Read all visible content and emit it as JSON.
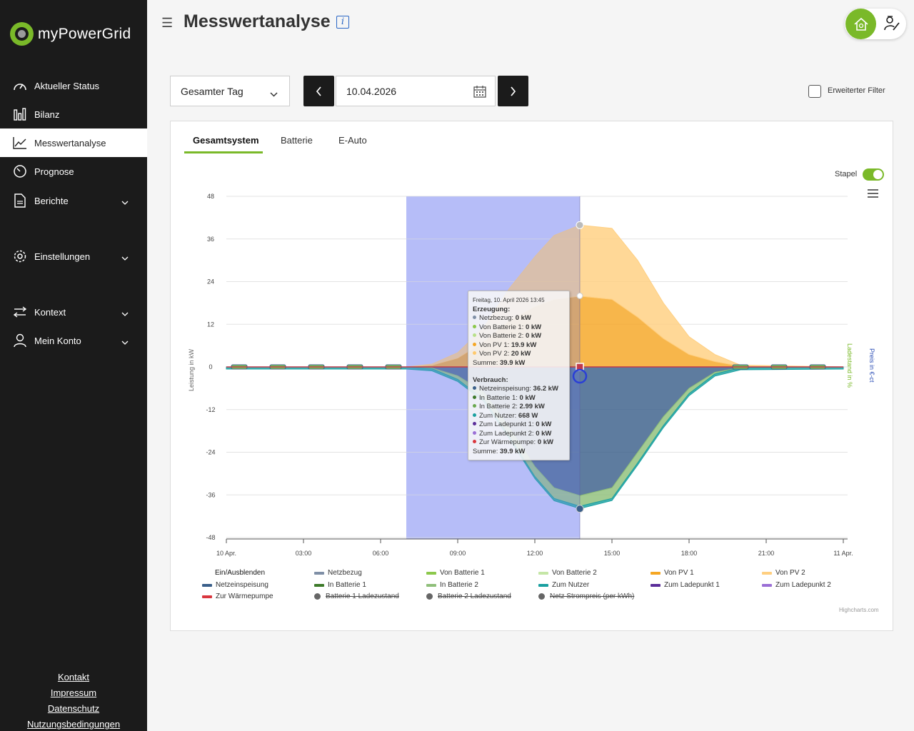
{
  "app": {
    "name": "myPowerGrid"
  },
  "sidebar": {
    "items": [
      {
        "label": "Aktueller Status",
        "icon": "gauge-icon"
      },
      {
        "label": "Bilanz",
        "icon": "bar-chart-icon"
      },
      {
        "label": "Messwertanalyse",
        "icon": "line-chart-icon",
        "active": true
      },
      {
        "label": "Prognose",
        "icon": "timer-icon"
      },
      {
        "label": "Berichte",
        "icon": "document-icon",
        "expandable": true
      },
      {
        "label": "Einstellungen",
        "icon": "gear-icon",
        "expandable": true
      },
      {
        "label": "Kontext",
        "icon": "swap-arrows-icon",
        "expandable": true
      },
      {
        "label": "Mein Konto",
        "icon": "user-icon",
        "expandable": true
      }
    ],
    "footer": [
      "Kontakt",
      "Impressum",
      "Datenschutz",
      "Nutzungsbedingungen"
    ]
  },
  "header": {
    "title": "Messwertanalyse",
    "info_icon": "i"
  },
  "controls": {
    "period": "Gesamter Tag",
    "date": "10.04.2026",
    "filter_label": "Erweiterter Filter",
    "filter_checked": false
  },
  "tabs": [
    "Gesamtsystem",
    "Batterie",
    "E-Auto"
  ],
  "active_tab": "Gesamtsystem",
  "stack_label": "Stapel",
  "stack_enabled": true,
  "tooltip": {
    "date": "Freitag, 10. April 2026 13:45",
    "gen_title": "Erzeugung:",
    "gen": [
      {
        "label": "Netzbezug:",
        "value": "0 kW",
        "color": "#7f8fa6"
      },
      {
        "label": "Von Batterie 1:",
        "value": "0 kW",
        "color": "#8cc84b"
      },
      {
        "label": "Von Batterie 2:",
        "value": "0 kW",
        "color": "#b8e08a"
      },
      {
        "label": "Von PV 1:",
        "value": "19.9 kW",
        "color": "#f5a623"
      },
      {
        "label": "Von PV 2:",
        "value": "20 kW",
        "color": "#ffc96b"
      }
    ],
    "gen_sum": {
      "label": "Summe:",
      "value": "39.9 kW"
    },
    "cons_title": "Verbrauch:",
    "cons": [
      {
        "label": "Netzeinspeisung:",
        "value": "36.2 kW",
        "color": "#3a5f8a"
      },
      {
        "label": "In Batterie 1:",
        "value": "0 kW",
        "color": "#3d7a2a"
      },
      {
        "label": "In Batterie 2:",
        "value": "2.99 kW",
        "color": "#6aa84f"
      },
      {
        "label": "Zum Nutzer:",
        "value": "668 W",
        "color": "#1aa0a0"
      },
      {
        "label": "Zum Ladepunkt 1:",
        "value": "0 kW",
        "color": "#5b2d9a"
      },
      {
        "label": "Zum Ladepunkt 2:",
        "value": "0 kW",
        "color": "#9b6fd6"
      },
      {
        "label": "Zur Wärmepumpe:",
        "value": "0 kW",
        "color": "#d9363e"
      }
    ],
    "cons_sum": {
      "label": "Summe:",
      "value": "39.9 kW"
    }
  },
  "legend": {
    "title": "Ein/Ausblenden",
    "items": [
      {
        "label": "Netzbezug",
        "color": "#7f8fa6",
        "type": "line"
      },
      {
        "label": "Von Batterie 1",
        "color": "#8cc84b",
        "type": "line"
      },
      {
        "label": "Von Batterie 2",
        "color": "#c5e6a6",
        "type": "line"
      },
      {
        "label": "Von PV 1",
        "color": "#f5a623",
        "type": "line"
      },
      {
        "label": "Von PV 2",
        "color": "#ffcf80",
        "type": "line"
      },
      {
        "label": "Netzeinspeisung",
        "color": "#3a5f8a",
        "type": "line"
      },
      {
        "label": "In Batterie 1",
        "color": "#3d7a2a",
        "type": "line"
      },
      {
        "label": "In Batterie 2",
        "color": "#8fbf7a",
        "type": "line"
      },
      {
        "label": "Zum Nutzer",
        "color": "#1aa0a0",
        "type": "line"
      },
      {
        "label": "Zum Ladepunkt 1",
        "color": "#5b2d9a",
        "type": "line"
      },
      {
        "label": "Zum Ladepunkt 2",
        "color": "#9b6fd6",
        "type": "line"
      },
      {
        "label": "Zur Wärmepumpe",
        "color": "#d9363e",
        "type": "line"
      },
      {
        "label": "Batterie 1 Ladezustand",
        "color": "#666666",
        "type": "circle",
        "hidden": true
      },
      {
        "label": "Batterie 2 Ladezustand",
        "color": "#666666",
        "type": "circle",
        "hidden": true
      },
      {
        "label": "Netz Strompreis (per kWh)",
        "color": "#666666",
        "type": "circle",
        "hidden": true
      }
    ]
  },
  "credits": "Highcharts.com",
  "chart_data": {
    "type": "area",
    "stacked": true,
    "ylabel": "Leistung in kW",
    "ylabel_right_1": "Ladestand in %",
    "ylabel_right_2": "Preis in €-ct",
    "ylim": [
      -48,
      48
    ],
    "yticks": [
      "48",
      "36",
      "24",
      "12",
      "0",
      "-12",
      "-24",
      "-36",
      "-48"
    ],
    "xtick_labels": [
      "10 Apr.",
      "03:00",
      "06:00",
      "09:00",
      "12:00",
      "15:00",
      "18:00",
      "21:00",
      "11 Apr."
    ],
    "x_hours": [
      0,
      3,
      6,
      7,
      8,
      9,
      10,
      11,
      12,
      12.75,
      13.75,
      15,
      16,
      17,
      18,
      19,
      20,
      24
    ],
    "series": [
      {
        "name": "Von PV 1",
        "color": "#f5a623",
        "values": [
          0,
          0,
          0,
          0,
          0.5,
          2.5,
          7,
          13,
          17,
          19,
          19.9,
          19,
          14,
          8,
          3.5,
          1.5,
          0.2,
          0
        ]
      },
      {
        "name": "Von PV 2",
        "color": "#ffcf80",
        "values": [
          0,
          0,
          0,
          0,
          0.3,
          1.5,
          4,
          9,
          14,
          18,
          20,
          20,
          16,
          10,
          5,
          2,
          0.3,
          0
        ]
      },
      {
        "name": "Netzeinspeisung",
        "color": "#3a5f8a",
        "values": [
          0,
          0,
          0,
          0,
          -0.3,
          -2.5,
          -7,
          -17,
          -28,
          -34,
          -36.2,
          -34,
          -24,
          -14,
          -6,
          -1.5,
          -0.2,
          0
        ]
      },
      {
        "name": "In Batterie 2",
        "color": "#8fbf7a",
        "values": [
          0,
          0,
          0,
          0,
          -0.2,
          -1,
          -2,
          -2.5,
          -2.8,
          -3,
          -2.99,
          -3,
          -3,
          -2.5,
          -1.5,
          -0.5,
          0,
          0
        ]
      },
      {
        "name": "Zum Nutzer",
        "color": "#1aa0a0",
        "values": [
          -0.6,
          -0.6,
          -0.6,
          -0.6,
          -0.6,
          -0.6,
          -0.6,
          -0.6,
          -0.6,
          -0.65,
          -0.668,
          -0.6,
          -0.6,
          -0.6,
          -0.6,
          -0.6,
          -0.6,
          -0.6
        ]
      }
    ],
    "selection_hours": [
      7,
      13.75
    ],
    "hover_hour": 13.75
  }
}
